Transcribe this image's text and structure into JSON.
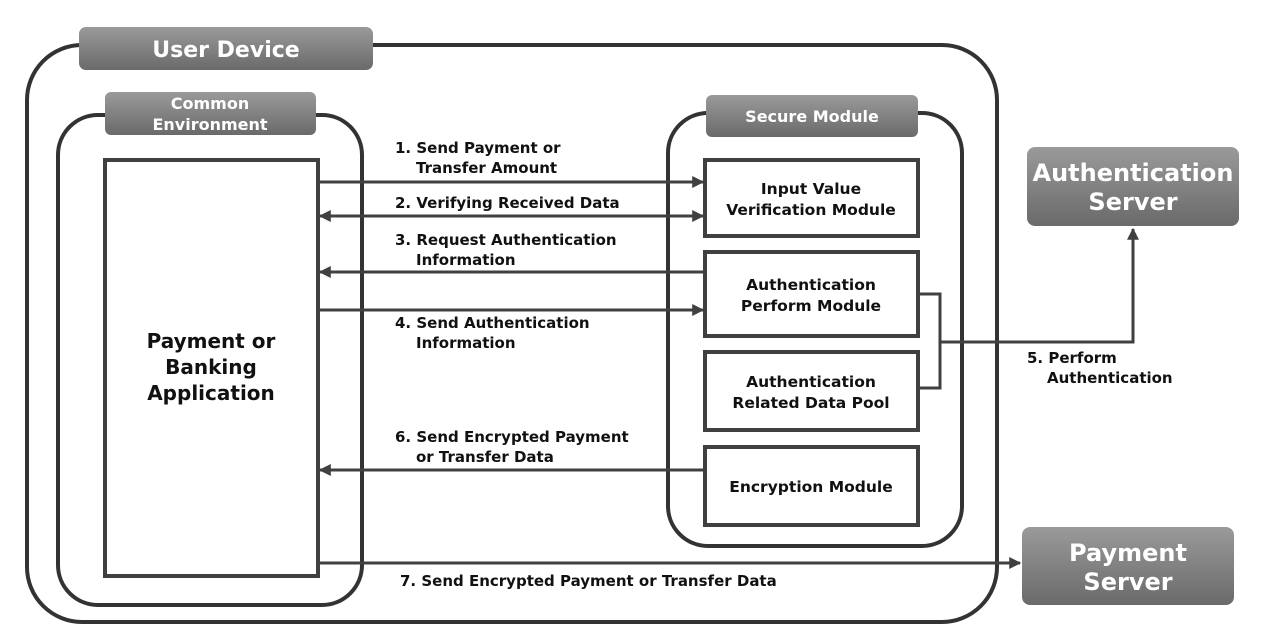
{
  "user_device": {
    "label": "User Device"
  },
  "common_environment": {
    "label": [
      "Common",
      "Environment"
    ]
  },
  "application": {
    "label": [
      "Payment or",
      "Banking",
      "Application"
    ]
  },
  "secure_module": {
    "label": "Secure Module",
    "modules": [
      {
        "label": [
          "Input Value",
          "Verification Module"
        ]
      },
      {
        "label": [
          "Authentication",
          "Perform Module"
        ]
      },
      {
        "label": [
          "Authentication",
          "Related Data Pool"
        ]
      },
      {
        "label": [
          "Encryption Module"
        ]
      }
    ]
  },
  "authentication_server": {
    "label": [
      "Authentication",
      "Server"
    ]
  },
  "payment_server": {
    "label": [
      "Payment",
      "Server"
    ]
  },
  "flows": [
    {
      "label": [
        "1. Send Payment or",
        "Transfer Amount"
      ]
    },
    {
      "label": [
        "2. Verifying Received Data"
      ]
    },
    {
      "label": [
        "3. Request Authentication",
        "Information"
      ]
    },
    {
      "label": [
        "4. Send Authentication",
        "Information"
      ]
    },
    {
      "label": [
        "5. Perform",
        "Authentication"
      ]
    },
    {
      "label": [
        "6. Send Encrypted Payment",
        "or Transfer Data"
      ]
    },
    {
      "label": [
        "7. Send Encrypted Payment or Transfer Data"
      ]
    }
  ],
  "colors": {
    "label_fill_top": "#9a9a9a",
    "label_fill_bottom": "#6a6a6a",
    "stroke": "#404040"
  }
}
